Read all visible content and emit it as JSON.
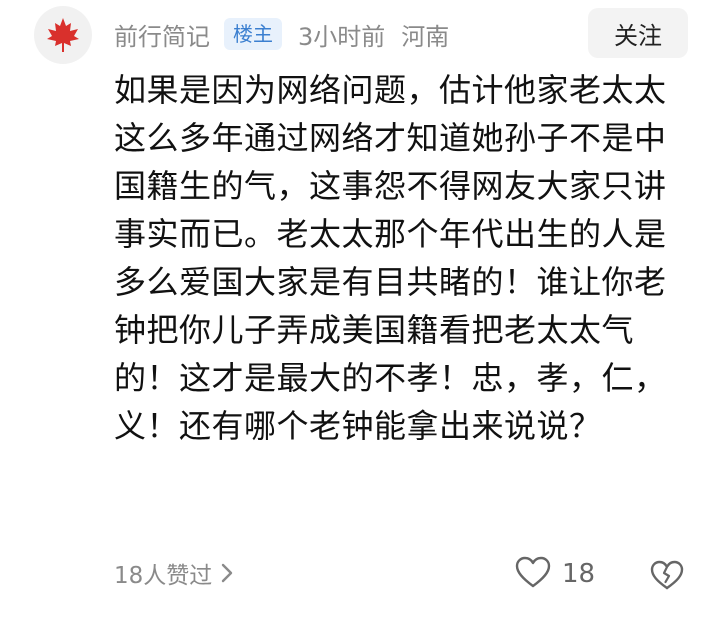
{
  "comment": {
    "author": {
      "name": "前行简记",
      "badge": "楼主",
      "avatar_icon": "maple-leaf-icon"
    },
    "time": "3小时前",
    "location": "河南",
    "follow_label": "关注",
    "text": "如果是因为网络问题，估计他家老太太这么多年通过网络才知道她孙子不是中国籍生的气，这事怨不得网友大家只讲事实而已。老太太那个年代出生的人是多么爱国大家是有目共睹的！谁让你老钟把你儿子弄成美国籍看把老太太气的！这才是最大的不孝！忠，孝，仁，义！还有哪个老钟能拿出来说说？",
    "likes_summary": "18人赞过",
    "like_count": "18",
    "colors": {
      "badge_text": "#3b7fd0",
      "badge_bg": "#e8f1fc",
      "meta_text": "#8a8a8a",
      "avatar_leaf": "#d9302c"
    }
  }
}
